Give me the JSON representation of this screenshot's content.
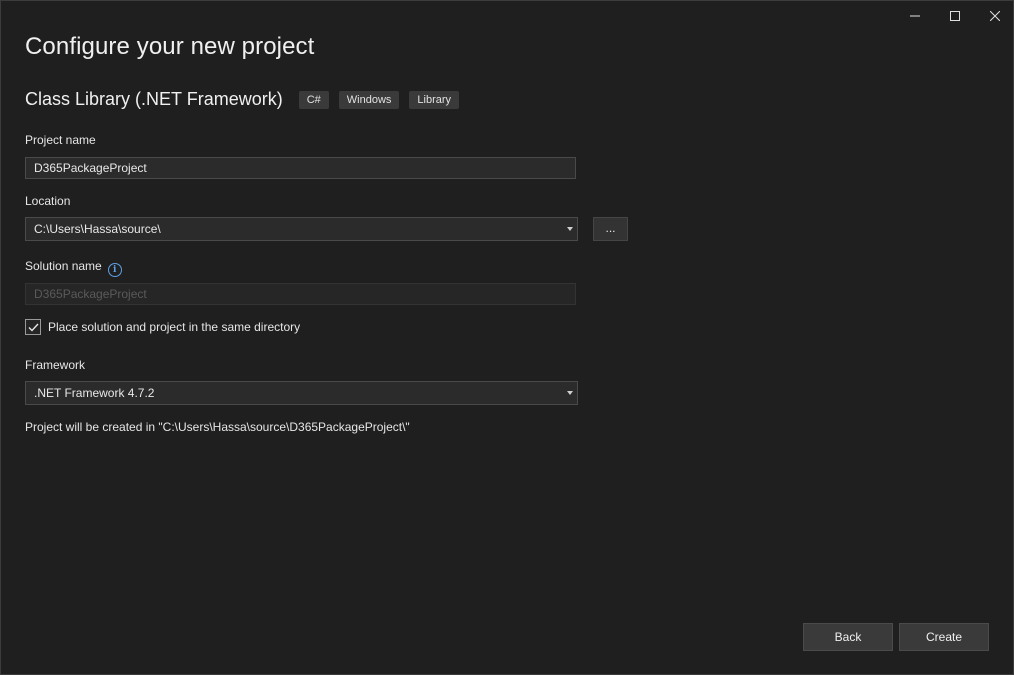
{
  "title": "Configure your new project",
  "template": {
    "name": "Class Library (.NET Framework)",
    "tags": [
      "C#",
      "Windows",
      "Library"
    ]
  },
  "fields": {
    "project_name": {
      "label": "Project name",
      "value": "D365PackageProject"
    },
    "location": {
      "label": "Location",
      "value": "C:\\Users\\Hassa\\source\\",
      "browse_label": "..."
    },
    "solution_name": {
      "label": "Solution name",
      "value": "D365PackageProject"
    },
    "same_directory": {
      "label": "Place solution and project in the same directory",
      "checked": true
    },
    "framework": {
      "label": "Framework",
      "value": ".NET Framework 4.7.2"
    }
  },
  "status_text": "Project will be created in \"C:\\Users\\Hassa\\source\\D365PackageProject\\\"",
  "buttons": {
    "back": "Back",
    "create": "Create"
  },
  "colors": {
    "background": "#1f1f1f",
    "input_background": "#2b2b2b",
    "info_accent": "#5ea0e6"
  },
  "icons": {
    "minimize": "minimize-icon",
    "maximize": "maximize-icon",
    "close": "close-icon",
    "info": "info-icon",
    "dropdown": "chevron-down-icon",
    "check": "checkmark-icon"
  }
}
